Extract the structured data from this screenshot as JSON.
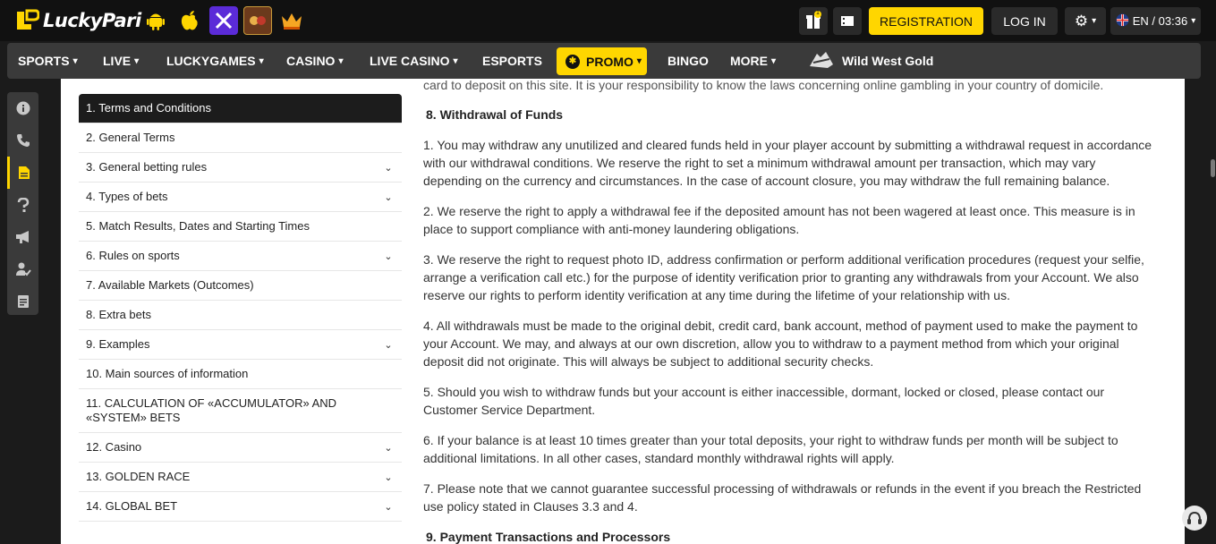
{
  "header": {
    "logo_text": "LuckyPari",
    "apps": [
      "android-icon",
      "apple-icon",
      "x-app-icon",
      "game-app-icon",
      "crown-icon"
    ],
    "gift_count": "1",
    "registration_label": "REGISTRATION",
    "login_label": "LOG IN",
    "language_time": "EN / 03:36",
    "accent_color": "#ffd600"
  },
  "nav": {
    "items": [
      {
        "label": "SPORTS"
      },
      {
        "label": "LIVE"
      },
      {
        "label": "LUCKYGAMES"
      },
      {
        "label": "CASINO"
      },
      {
        "label": "LIVE CASINO"
      },
      {
        "label": "ESPORTS"
      },
      {
        "label": "PROMO"
      },
      {
        "label": "BINGO"
      },
      {
        "label": "MORE"
      }
    ],
    "featured_game": "Wild West Gold"
  },
  "rail": [
    "info-icon",
    "phone-icon",
    "document-icon",
    "question-icon",
    "megaphone-icon",
    "user-check-icon",
    "notes-icon"
  ],
  "toc": [
    {
      "label": "1. Terms and Conditions"
    },
    {
      "label": "2. General Terms"
    },
    {
      "label": "3. General betting rules"
    },
    {
      "label": "4. Types of bets"
    },
    {
      "label": "5. Match Results, Dates and Starting Times"
    },
    {
      "label": "6. Rules on sports"
    },
    {
      "label": "7. Available Markets (Outcomes)"
    },
    {
      "label": "8. Extra bets"
    },
    {
      "label": "9. Examples"
    },
    {
      "label": "10. Main sources of information"
    },
    {
      "label": "11. CALCULATION OF «ACCUMULATOR» AND «SYSTEM» BETS"
    },
    {
      "label": "12. Casino"
    },
    {
      "label": "13. GOLDEN RACE"
    },
    {
      "label": "14. GLOBAL BET"
    }
  ],
  "article": {
    "cut_top": "card to deposit on this site. It is your responsibility to know  the laws concerning online gambling in your country of domicile.",
    "heading": "8. Withdrawal of Funds",
    "paragraphs": [
      "1. You may withdraw any unutilized and cleared funds held in your player account by  submitting a withdrawal request in accordance with our withdrawal conditions. We reserve the  right to set a minimum withdrawal amount per transaction, which may vary depending on the currency and circumstances. In the case of account closure, you may withdraw the full  remaining balance.",
      "2. We reserve the right to apply a withdrawal fee if the deposited amount has not been  wagered at least once. This measure is in place to support compliance with anti-money  laundering obligations.",
      "3. We reserve the right to request photo ID, address confirmation or perform additional  verification procedures (request your selfie, arrange a verification call etc.) for the purpose of  identity verification prior to granting any withdrawals from your Account. We also reserve our  rights to perform identity verification at any time during the lifetime of your relationship with us.",
      "4. All withdrawals must be made to the original debit, credit card, bank account, method of  payment used to make the payment to your Account. We may, and always at our own  discretion, allow you to withdraw to a payment method from which your original deposit did not  originate. This will always be subject to additional security checks.",
      "5. Should you wish to withdraw funds but your account is either inaccessible, dormant, locked  or closed, please contact our Customer Service Department.",
      "6. If your balance is at least 10 times greater than your total deposits, your right to withdraw  funds per month will be subject to additional limitations. In all other cases, standard monthly  withdrawal rights will apply.",
      "7. Please note that we cannot guarantee successful processing of withdrawals or refunds in  the event if you breach the Restricted use policy stated in Clauses 3.3 and 4."
    ],
    "next_heading": "9. Payment Transactions and Processors"
  }
}
